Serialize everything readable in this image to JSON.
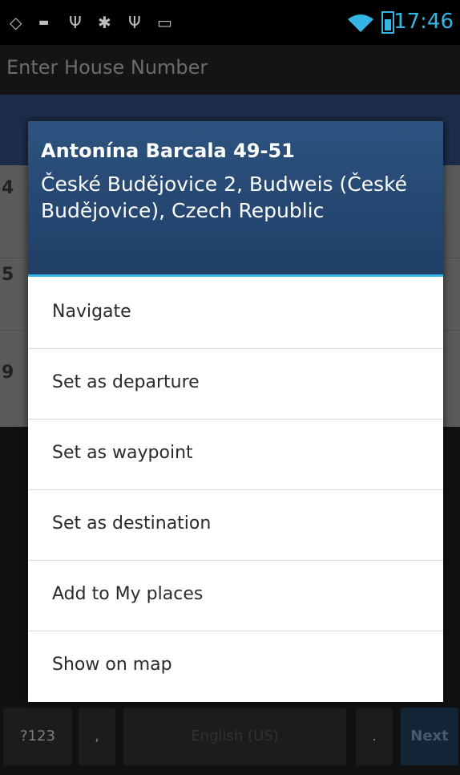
{
  "status_bar": {
    "time": "17:46",
    "accent_color": "#33b5e5"
  },
  "app": {
    "title": "Enter House Number",
    "list_numbers": [
      "4",
      "5",
      "9"
    ]
  },
  "keyboard": {
    "symbols_key": "?123",
    "comma_key": ",",
    "space_key": "English (US)",
    "period_key": ".",
    "next_key": "Next"
  },
  "dialog": {
    "title": "Antonína Barcala 49-51",
    "subtitle": "České Budějovice 2, Budweis (České Budějovice), Czech Republic",
    "header_color": "#25476f",
    "items": [
      {
        "label": "Navigate"
      },
      {
        "label": "Set as departure"
      },
      {
        "label": "Set as waypoint"
      },
      {
        "label": "Set as destination"
      },
      {
        "label": "Add to My places"
      },
      {
        "label": "Show on map"
      }
    ]
  }
}
